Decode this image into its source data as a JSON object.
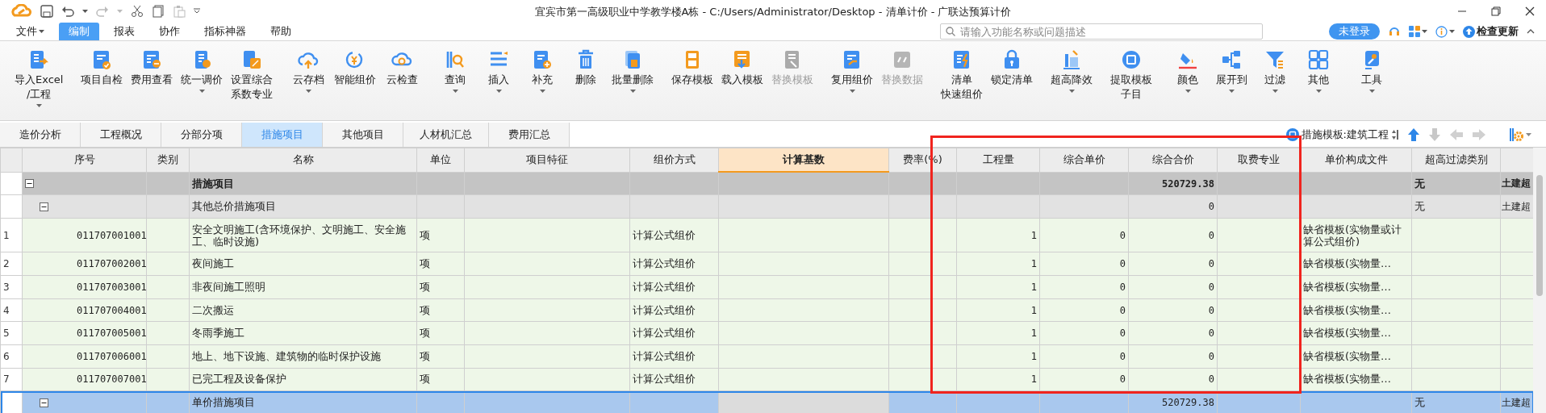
{
  "window": {
    "title": "宜宾市第一高级职业中学教学楼A栋 - C:/Users/Administrator/Desktop - 清单计价 - 广联达预算计价"
  },
  "menu": [
    {
      "label": "文件",
      "selected": false,
      "dropdown": true
    },
    {
      "label": "编制",
      "selected": true,
      "dropdown": false
    },
    {
      "label": "报表",
      "selected": false,
      "dropdown": false
    },
    {
      "label": "协作",
      "selected": false,
      "dropdown": false
    },
    {
      "label": "指标神器",
      "selected": false,
      "dropdown": false
    },
    {
      "label": "帮助",
      "selected": false,
      "dropdown": false
    }
  ],
  "search": {
    "placeholder": "请输入功能名称或问题描述"
  },
  "login_button": "未登录",
  "update_button": "检查更新",
  "toolbar": {
    "groups": [
      {
        "items": [
          {
            "lines": [
              "导入Excel",
              "/工程"
            ],
            "dropdown": true,
            "disabled": false
          }
        ]
      },
      {
        "items": [
          {
            "lines": [
              "项目自检"
            ],
            "dropdown": false,
            "disabled": false
          },
          {
            "lines": [
              "费用查看"
            ],
            "dropdown": false,
            "disabled": false
          },
          {
            "lines": [
              "统一调价"
            ],
            "dropdown": true,
            "disabled": false
          },
          {
            "lines": [
              "设置综合",
              "系数专业"
            ],
            "dropdown": false,
            "disabled": false
          }
        ]
      },
      {
        "items": [
          {
            "lines": [
              "云存档"
            ],
            "dropdown": true,
            "disabled": false
          },
          {
            "lines": [
              "智能组价"
            ],
            "dropdown": false,
            "disabled": false
          },
          {
            "lines": [
              "云检查"
            ],
            "dropdown": false,
            "disabled": false
          }
        ]
      },
      {
        "items": [
          {
            "lines": [
              "查询"
            ],
            "dropdown": true,
            "disabled": false
          },
          {
            "lines": [
              "插入"
            ],
            "dropdown": true,
            "disabled": false
          },
          {
            "lines": [
              "补充"
            ],
            "dropdown": true,
            "disabled": false
          },
          {
            "lines": [
              "删除"
            ],
            "dropdown": false,
            "disabled": false
          },
          {
            "lines": [
              "批量删除"
            ],
            "dropdown": true,
            "disabled": false
          }
        ]
      },
      {
        "items": [
          {
            "lines": [
              "保存模板"
            ],
            "dropdown": false,
            "disabled": false
          },
          {
            "lines": [
              "载入模板"
            ],
            "dropdown": false,
            "disabled": false
          },
          {
            "lines": [
              "替换模板"
            ],
            "dropdown": false,
            "disabled": true
          }
        ]
      },
      {
        "items": [
          {
            "lines": [
              "复用组价"
            ],
            "dropdown": true,
            "disabled": false
          },
          {
            "lines": [
              "替换数据"
            ],
            "dropdown": false,
            "disabled": true
          }
        ]
      },
      {
        "items": [
          {
            "lines": [
              "清单",
              "快速组价"
            ],
            "dropdown": false,
            "disabled": false
          },
          {
            "lines": [
              "锁定清单"
            ],
            "dropdown": false,
            "disabled": false
          }
        ]
      },
      {
        "items": [
          {
            "lines": [
              "超高降效"
            ],
            "dropdown": true,
            "disabled": false
          }
        ]
      },
      {
        "items": [
          {
            "lines": [
              "提取模板",
              "子目"
            ],
            "dropdown": false,
            "disabled": false
          }
        ]
      },
      {
        "items": [
          {
            "lines": [
              "颜色"
            ],
            "dropdown": true,
            "disabled": false
          },
          {
            "lines": [
              "展开到"
            ],
            "dropdown": true,
            "disabled": false
          },
          {
            "lines": [
              "过滤"
            ],
            "dropdown": true,
            "disabled": false
          },
          {
            "lines": [
              "其他"
            ],
            "dropdown": true,
            "disabled": false
          }
        ]
      },
      {
        "items": [
          {
            "lines": [
              "工具"
            ],
            "dropdown": true,
            "disabled": false
          }
        ]
      }
    ]
  },
  "tabs": [
    {
      "label": "造价分析",
      "selected": false
    },
    {
      "label": "工程概况",
      "selected": false
    },
    {
      "label": "分部分项",
      "selected": false
    },
    {
      "label": "措施项目",
      "selected": true
    },
    {
      "label": "其他项目",
      "selected": false
    },
    {
      "label": "人材机汇总",
      "selected": false
    },
    {
      "label": "费用汇总",
      "selected": false
    }
  ],
  "template_label": "措施模板:建筑工程",
  "table": {
    "columns": [
      {
        "label": "序号",
        "selected": false
      },
      {
        "label": "类别",
        "selected": false
      },
      {
        "label": "名称",
        "selected": false
      },
      {
        "label": "单位",
        "selected": false
      },
      {
        "label": "项目特征",
        "selected": false
      },
      {
        "label": "组价方式",
        "selected": false
      },
      {
        "label": "计算基数",
        "selected": true
      },
      {
        "label": "费率(%)",
        "selected": false
      },
      {
        "label": "工程量",
        "selected": false
      },
      {
        "label": "综合单价",
        "selected": false
      },
      {
        "label": "综合合价",
        "selected": false
      },
      {
        "label": "取费专业",
        "selected": false
      },
      {
        "label": "单价构成文件",
        "selected": false
      },
      {
        "label": "超高过滤类别",
        "selected": false
      }
    ],
    "rows": [
      {
        "kind": "group",
        "selected": false,
        "expanded": true,
        "name": "措施项目",
        "total": "520729.38",
        "filter_category": "无",
        "column_15": "土建超",
        "children": [
          {
            "kind": "subgroup",
            "selected": false,
            "expanded": true,
            "name": "其他总价措施项目",
            "total": "0",
            "filter_category": "无",
            "column_15": "土建超",
            "children": [
              {
                "kind": "item",
                "selected": false,
                "number": "1",
                "code": "011707001001",
                "name": "安全文明施工(含环境保护、文明施工、安全施工、临时设施)",
                "unit": "项",
                "pricing_method": "计算公式组价",
                "quantity": "1",
                "unit_price": "0",
                "total": "0",
                "price_file": "缺省模板(实物量或计算公式组价)"
              },
              {
                "kind": "item",
                "selected": false,
                "number": "2",
                "code": "011707002001",
                "name": "夜间施工",
                "unit": "项",
                "pricing_method": "计算公式组价",
                "quantity": "1",
                "unit_price": "0",
                "total": "0",
                "price_file": "缺省模板(实物量…"
              },
              {
                "kind": "item",
                "selected": false,
                "number": "3",
                "code": "011707003001",
                "name": "非夜间施工照明",
                "unit": "项",
                "pricing_method": "计算公式组价",
                "quantity": "1",
                "unit_price": "0",
                "total": "0",
                "price_file": "缺省模板(实物量…"
              },
              {
                "kind": "item",
                "selected": false,
                "number": "4",
                "code": "011707004001",
                "name": "二次搬运",
                "unit": "项",
                "pricing_method": "计算公式组价",
                "quantity": "1",
                "unit_price": "0",
                "total": "0",
                "price_file": "缺省模板(实物量…"
              },
              {
                "kind": "item",
                "selected": false,
                "number": "5",
                "code": "011707005001",
                "name": "冬雨季施工",
                "unit": "项",
                "pricing_method": "计算公式组价",
                "quantity": "1",
                "unit_price": "0",
                "total": "0",
                "price_file": "缺省模板(实物量…"
              },
              {
                "kind": "item",
                "selected": false,
                "number": "6",
                "code": "011707006001",
                "name": "地上、地下设施、建筑物的临时保护设施",
                "unit": "项",
                "pricing_method": "计算公式组价",
                "quantity": "1",
                "unit_price": "0",
                "total": "0",
                "price_file": "缺省模板(实物量…"
              },
              {
                "kind": "item",
                "selected": false,
                "number": "7",
                "code": "011707007001",
                "name": "已完工程及设备保护",
                "unit": "项",
                "pricing_method": "计算公式组价",
                "quantity": "1",
                "unit_price": "0",
                "total": "0",
                "price_file": "缺省模板(实物量…"
              }
            ]
          },
          {
            "kind": "subgroup",
            "selected": true,
            "expanded": true,
            "name": "单价措施项目",
            "total": "520729.38",
            "filter_category": "无",
            "column_15": "土建超"
          }
        ]
      }
    ]
  }
}
